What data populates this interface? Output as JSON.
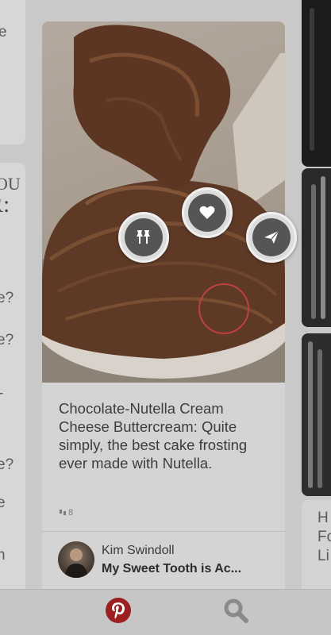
{
  "left_column": {
    "card1_lines": [
      "e"
    ],
    "card2_lines": [
      "OU",
      "R:",
      "e?",
      "e?",
      "-",
      "e?",
      "e",
      "n"
    ]
  },
  "main_pin": {
    "description": "Chocolate-Nutella Cream Cheese Buttercream: Quite simply, the best cake frosting ever made with Nutella.",
    "repin_count": "8",
    "pinner_name": "Kim Swindoll",
    "board_name": "My Sweet Tooth is Ac..."
  },
  "right_column": {
    "card4_lines": [
      "H",
      "Fo",
      "Li"
    ]
  },
  "actions": {
    "pin": "pin-it-icon",
    "like": "heart-icon",
    "send": "send-icon"
  },
  "tabbar": {
    "home": "pinterest-logo-icon",
    "search": "search-icon"
  },
  "colors": {
    "brand_red": "#9c1f22",
    "overlay_gray": "#555555",
    "touch_ring": "#c04040"
  }
}
